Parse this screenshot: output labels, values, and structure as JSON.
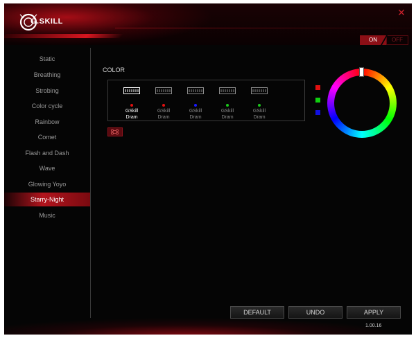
{
  "header": {
    "logo_text": "G.SKILL",
    "close_icon": "close-icon",
    "toggle": {
      "on_label": "ON",
      "off_label": "OFF",
      "state": "on"
    }
  },
  "sidebar": {
    "items": [
      {
        "label": "Static",
        "active": false
      },
      {
        "label": "Breathing",
        "active": false
      },
      {
        "label": "Strobing",
        "active": false
      },
      {
        "label": "Color cycle",
        "active": false
      },
      {
        "label": "Rainbow",
        "active": false
      },
      {
        "label": "Comet",
        "active": false
      },
      {
        "label": "Flash and Dash",
        "active": false
      },
      {
        "label": "Wave",
        "active": false
      },
      {
        "label": "Glowing Yoyo",
        "active": false
      },
      {
        "label": "Starry-Night",
        "active": true
      },
      {
        "label": "Music",
        "active": false
      }
    ]
  },
  "main": {
    "color_label": "COLOR",
    "modules": [
      {
        "line1": "GSkill",
        "line2": "Dram",
        "dot_color": "#e01010",
        "selected": true
      },
      {
        "line1": "GSkill",
        "line2": "Dram",
        "dot_color": "#e01010",
        "selected": false
      },
      {
        "line1": "GSkill",
        "line2": "Dram",
        "dot_color": "#1a1aff",
        "selected": false
      },
      {
        "line1": "GSkill",
        "line2": "Dram",
        "dot_color": "#1ac81a",
        "selected": false
      },
      {
        "line1": "GSkill",
        "line2": "Dram",
        "dot_color": "#1ac81a",
        "selected": false
      }
    ],
    "link_icon": "link-modules-icon",
    "swatches": [
      {
        "name": "red",
        "color": "#e01010"
      },
      {
        "name": "green",
        "color": "#10d010"
      },
      {
        "name": "blue",
        "color": "#1010e0"
      }
    ],
    "color_wheel": "color-wheel"
  },
  "footer": {
    "default_label": "DEFAULT",
    "undo_label": "UNDO",
    "apply_label": "APPLY",
    "version": "1.00.16"
  },
  "colors": {
    "accent": "#b3141d",
    "background": "#050505"
  }
}
